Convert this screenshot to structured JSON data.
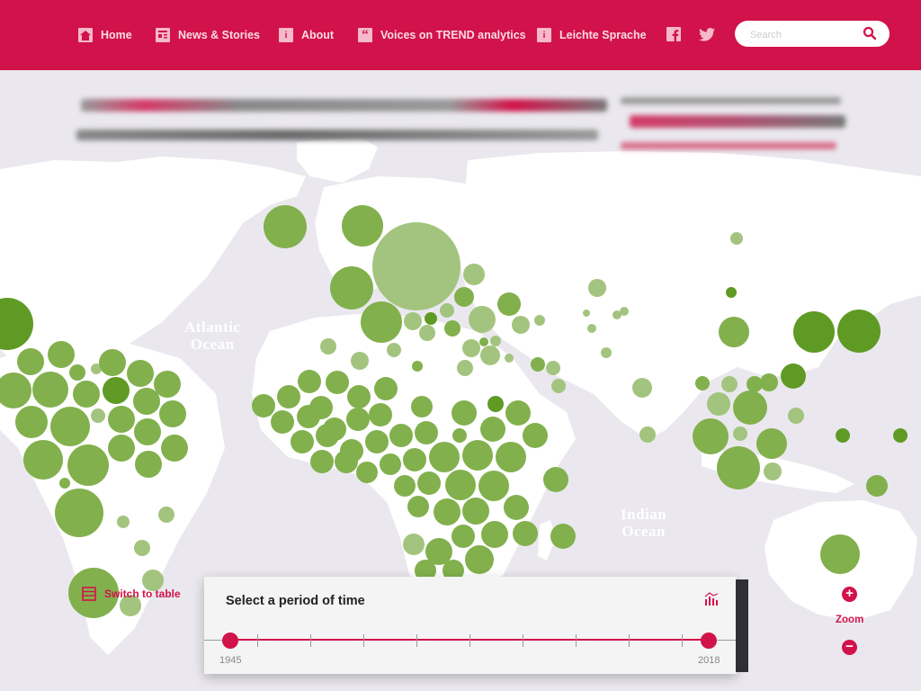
{
  "nav": {
    "items": [
      {
        "label": "Home",
        "icon": "home-icon",
        "glyph": "⌂"
      },
      {
        "label": "News & Stories",
        "icon": "news-icon",
        "glyph": "▤"
      },
      {
        "label": "About",
        "icon": "info-icon",
        "glyph": "i"
      },
      {
        "label": "Voices on TREND analytics",
        "icon": "quote-icon",
        "glyph": "“"
      },
      {
        "label": "Leichte Sprache",
        "icon": "info-icon",
        "glyph": "i"
      }
    ],
    "facebook": "f",
    "twitter": "t"
  },
  "search": {
    "placeholder": "Search"
  },
  "map": {
    "oceans": {
      "atlantic": "Atlantic\nOcean",
      "indian": "Indian\nOcean"
    }
  },
  "switch_label": "Switch to table",
  "period": {
    "title": "Select a period of time",
    "start_year": "1945",
    "end_year": "2018"
  },
  "zoom": {
    "label": "Zoom",
    "plus": "+",
    "minus": "−"
  },
  "colors": {
    "brand": "#d2124a",
    "bubble": "#82b04d"
  }
}
